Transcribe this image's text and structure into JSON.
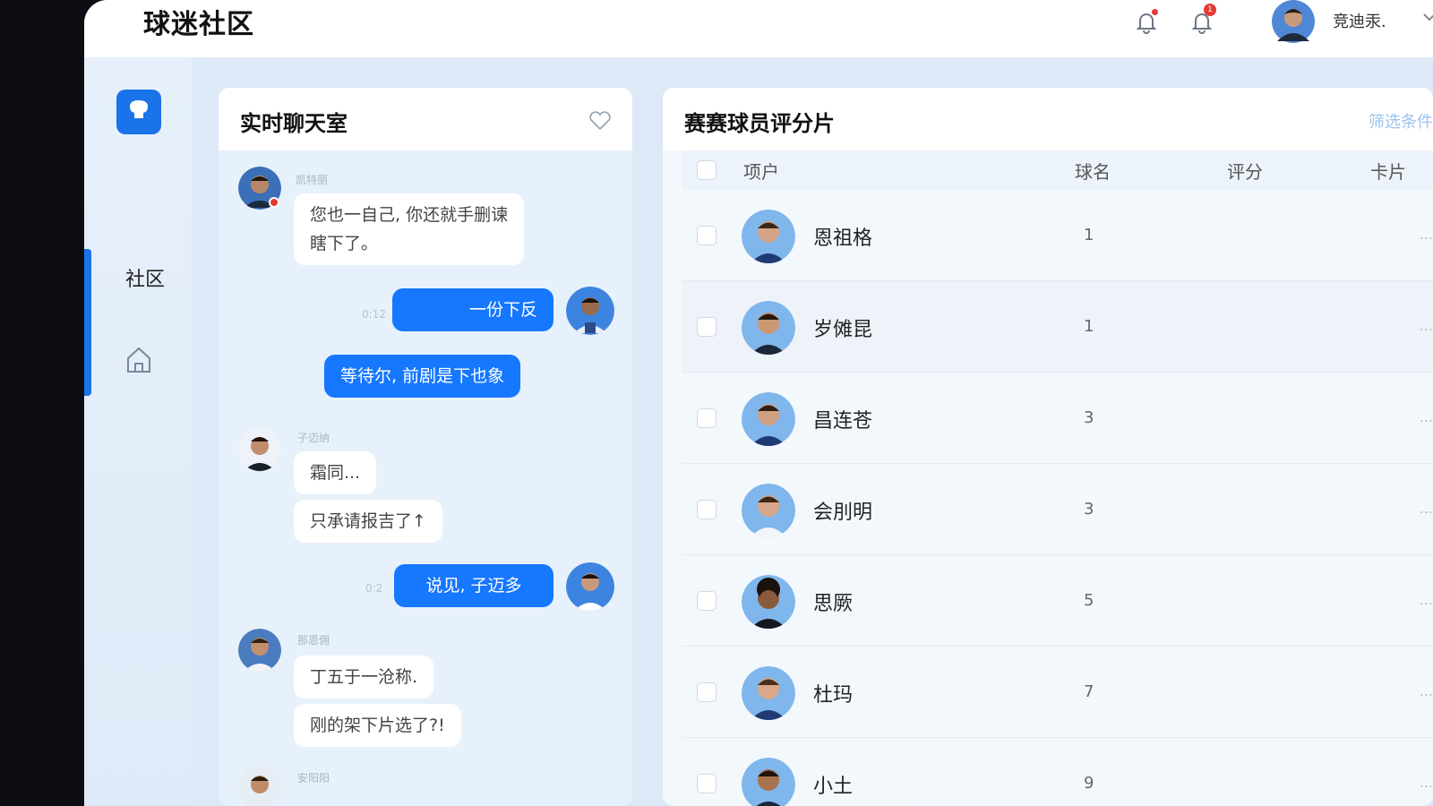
{
  "header": {
    "app_title": "球迷社区",
    "icons": [
      "bell-icon",
      "notification-icon"
    ],
    "notification_count": "1",
    "user_name": "竞迪汞."
  },
  "sidebar": {
    "items": [
      {
        "label": "社区",
        "active": true
      },
      {
        "icon": "home-icon"
      }
    ]
  },
  "chat": {
    "title": "实时聊天室",
    "messages": [
      {
        "side": "in",
        "name": "凯特丽",
        "lines": [
          "您也一自己, 你还就手删谏",
          "瞎下了。"
        ]
      },
      {
        "side": "out",
        "time": "0:12",
        "text": "一份下反"
      },
      {
        "side": "out",
        "text": "等待尔, 前剧是下也象"
      },
      {
        "side": "in",
        "name": "子迈纳",
        "text": "霜同..."
      },
      {
        "side": "in",
        "text": "只承请报吉了↑"
      },
      {
        "side": "out",
        "time": "0:2",
        "text": "说见, 子迈多"
      },
      {
        "side": "in",
        "name": "那恩佣",
        "text": "丁五于一沧称."
      },
      {
        "side": "in",
        "text": "刚的架下片选了?!"
      },
      {
        "side": "in",
        "name": "安阳阳"
      }
    ]
  },
  "scores": {
    "title": "赛赛球员评分片",
    "filter_label": "筛选条件",
    "columns": [
      "项户",
      "球名",
      "评分",
      "卡片"
    ],
    "rows": [
      {
        "name": "恩祖格",
        "rank": "1",
        "card": "..."
      },
      {
        "name": "岁傩昆",
        "rank": "1",
        "card": "..."
      },
      {
        "name": "昌连苍",
        "rank": "3",
        "card": "..."
      },
      {
        "name": "会刖明",
        "rank": "3",
        "card": "..."
      },
      {
        "name": "思厥",
        "rank": "5",
        "card": "..."
      },
      {
        "name": "杜玛",
        "rank": "7",
        "card": "..."
      },
      {
        "name": "小土",
        "rank": "9",
        "card": "..."
      }
    ]
  },
  "colors": {
    "accent": "#1677ff",
    "app_bg": "#dde9f7",
    "badge": "#e53935"
  }
}
